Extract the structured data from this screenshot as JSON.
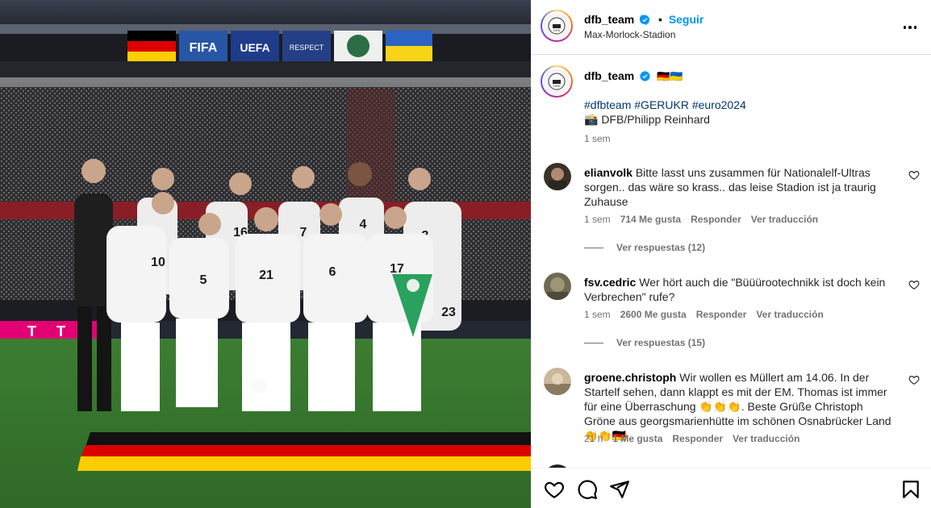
{
  "header": {
    "username": "dfb_team",
    "separator": "•",
    "follow_label": "Seguir",
    "location": "Max-Morlock-Stadion"
  },
  "caption": {
    "username": "dfb_team",
    "emoji": "🇩🇪🇺🇦",
    "hashtags": "#dfbteam #GERUKR #euro2024",
    "credit": "📸 DFB/Philipp Reinhard",
    "time": "1 sem"
  },
  "photo": {
    "boards": [
      "FIFA",
      "UEFA",
      "RESPECT"
    ],
    "jersey_numbers": [
      "10",
      "5",
      "21",
      "6",
      "17",
      "16",
      "7",
      "4",
      "3",
      "23"
    ]
  },
  "comments": [
    {
      "username": "elianvolk",
      "text": "Bitte lasst uns zusammen für Nationalelf-Ultras sorgen.. das wäre so krass.. das leise Stadion ist ja traurig Zuhause",
      "time": "1 sem",
      "likes": "714 Me gusta",
      "reply": "Responder",
      "translate": "Ver traducción",
      "replies": "Ver respuestas (12)"
    },
    {
      "username": "fsv.cedric",
      "text": "Wer hört auch die \"Büüürootechnikk ist doch kein Verbrechen\" rufe?",
      "time": "1 sem",
      "likes": "2600 Me gusta",
      "reply": "Responder",
      "translate": "Ver traducción",
      "replies": "Ver respuestas (15)"
    },
    {
      "username": "groene.christoph",
      "text": "Wir wollen es Müllert am 14.06. In der Startelf sehen, dann klappt es mit der EM. Thomas ist immer für eine Überraschung 👏👏👏. Beste Grüße Christoph Gröne aus georgsmarienhütte im schönen Osnabrücker Land👏👏🇩🇪",
      "time": "21 h",
      "likes": "1 Me gusta",
      "reply": "Responder",
      "translate": "Ver traducción"
    }
  ],
  "colors": {
    "accent": "#0095f6",
    "hashtag": "#00376b",
    "muted": "#737373",
    "verified": "#0095f6"
  },
  "icons": [
    "heart-icon",
    "comment-icon",
    "share-icon",
    "bookmark-icon",
    "more-options-icon",
    "verified-icon"
  ]
}
